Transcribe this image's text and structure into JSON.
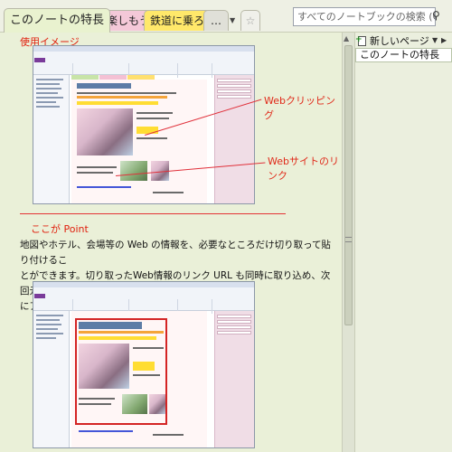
{
  "section_tabs": [
    {
      "label": "このノートの特長"
    },
    {
      "label": "桜を楽しもう"
    },
    {
      "label": "鉄道に乗ろう"
    },
    {
      "label": "…"
    }
  ],
  "search": {
    "placeholder": "すべてのノートブックの検索 (Ctrl+E)"
  },
  "pages_pane": {
    "new_page_label": "新しいページ",
    "pages": [
      {
        "title": "このノートの特長"
      }
    ]
  },
  "content": {
    "heading1": "使用イメージ",
    "callout1": "Webクリッピング",
    "callout2": "Webサイトのリンク",
    "heading2": "ここが Point",
    "body_lines": [
      "地図やホテル、会場等の Web の情報を、必要なところだけ切り取って貼り付けるこ",
      "とができます。切り取ったWeb情報のリンク URL も同時に取り込め、次回元のサイト",
      "にアクセスするときも便利です。"
    ]
  },
  "colors": {
    "accent_red": "#e0200e",
    "tab_active": "#e9f2cf",
    "tab_pink": "#f4c8d8",
    "tab_yellow": "#ffe86a"
  }
}
